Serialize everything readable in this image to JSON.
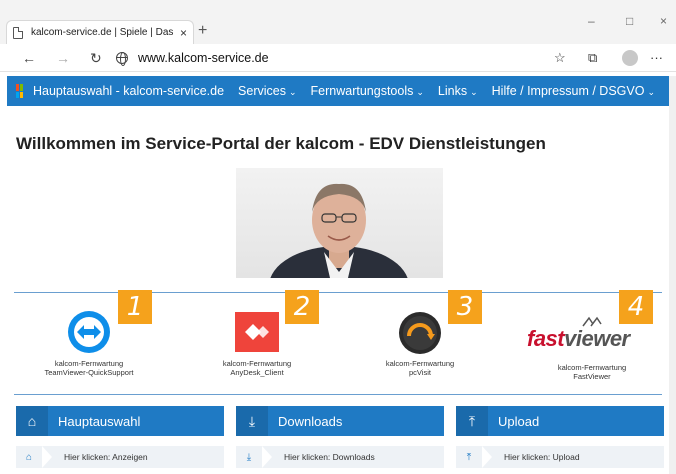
{
  "browser": {
    "tab_title": "kalcom-service.de | Spiele | Das S",
    "tab_close": "×",
    "new_tab": "+",
    "url": "www.kalcom-service.de",
    "minimize": "–",
    "maximize": "□",
    "close": "×",
    "back": "←",
    "forward": "→",
    "refresh": "↻",
    "favorites_icon": "☆",
    "collections_icon": "⧉",
    "more": "···"
  },
  "site_nav": {
    "items": [
      {
        "label": "Hauptauswahl - kalcom-service.de",
        "has_menu": false
      },
      {
        "label": "Services",
        "has_menu": true
      },
      {
        "label": "Fernwartungstools",
        "has_menu": true
      },
      {
        "label": "Links",
        "has_menu": true
      },
      {
        "label": "Hilfe / Impressum / DSGVO",
        "has_menu": true
      }
    ],
    "chevron": "⌄"
  },
  "headline": "Willkommen im Service-Portal der kalcom - EDV Dienstleistungen",
  "tools": [
    {
      "number": "1",
      "line1": "kalcom-Fernwartung",
      "line2": "TeamViewer-QuickSupport",
      "icon": "teamviewer-icon"
    },
    {
      "number": "2",
      "line1": "kalcom-Fernwartung",
      "line2": "AnyDesk_Client",
      "icon": "anydesk-icon"
    },
    {
      "number": "3",
      "line1": "kalcom-Fernwartung",
      "line2": "pcVisit",
      "icon": "pcvisit-icon"
    },
    {
      "number": "4",
      "line1": "kalcom-Fernwartung",
      "line2": "FastViewer",
      "icon": "fastviewer-logo"
    }
  ],
  "fastviewer_logo": {
    "part1": "fast",
    "part2": "viewer"
  },
  "panels": [
    {
      "title": "Hauptauswahl",
      "icon": "home-icon",
      "glyph": "⌂",
      "crumb": "Hier klicken: Anzeigen"
    },
    {
      "title": "Downloads",
      "icon": "download-icon",
      "glyph": "⤓",
      "crumb": "Hier klicken: Downloads"
    },
    {
      "title": "Upload",
      "icon": "upload-icon",
      "glyph": "⤒",
      "crumb": "Hier klicken: Upload"
    }
  ],
  "colors": {
    "nav_blue": "#1f7ac4",
    "badge_orange": "#f5a21c",
    "anydesk_red": "#ef443b",
    "teamviewer_blue": "#0e8ee9",
    "fastviewer_red": "#c8102e"
  }
}
